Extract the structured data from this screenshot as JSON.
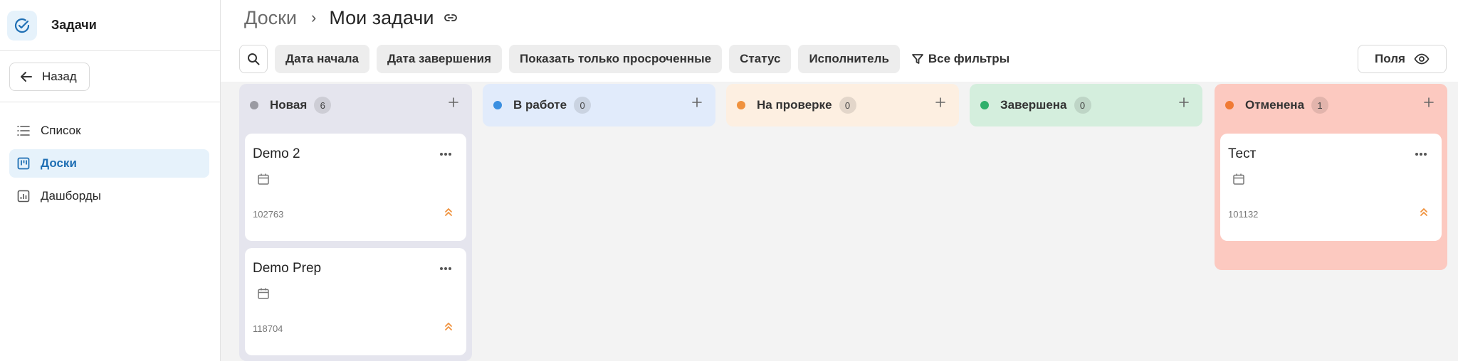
{
  "app": {
    "title": "Задачи"
  },
  "sidebar": {
    "back_label": "Назад",
    "items": [
      {
        "label": "Список",
        "icon": "list-icon",
        "active": false
      },
      {
        "label": "Доски",
        "icon": "board-icon",
        "active": true
      },
      {
        "label": "Дашборды",
        "icon": "dashboard-icon",
        "active": false
      }
    ]
  },
  "breadcrumb": {
    "parent": "Доски",
    "current": "Мои задачи"
  },
  "filters": {
    "chips": [
      "Дата начала",
      "Дата завершения",
      "Показать только просроченные",
      "Статус",
      "Исполнитель"
    ],
    "all_filters_label": "Все фильтры",
    "fields_label": "Поля"
  },
  "columns": [
    {
      "title": "Новая",
      "count": "6",
      "color": "#9a9aa2",
      "bg": "#e5e5ee",
      "cards": [
        {
          "title": "Demo 2",
          "id": "102763"
        },
        {
          "title": "Demo Prep",
          "id": "118704"
        }
      ]
    },
    {
      "title": "В работе",
      "count": "0",
      "color": "#3b8fe0",
      "bg": "#e1ebfb",
      "cards": []
    },
    {
      "title": "На проверке",
      "count": "0",
      "color": "#f0923e",
      "bg": "#fdefe1",
      "cards": []
    },
    {
      "title": "Завершена",
      "count": "0",
      "color": "#2fb06b",
      "bg": "#d4eedd",
      "cards": []
    },
    {
      "title": "Отменена",
      "count": "1",
      "color": "#f07a34",
      "bg": "#fcc9c0",
      "cards": [
        {
          "title": "Тест",
          "id": "101132"
        }
      ]
    }
  ],
  "colors": {
    "accent": "#1f6fb4",
    "priority": "#f0923e"
  }
}
